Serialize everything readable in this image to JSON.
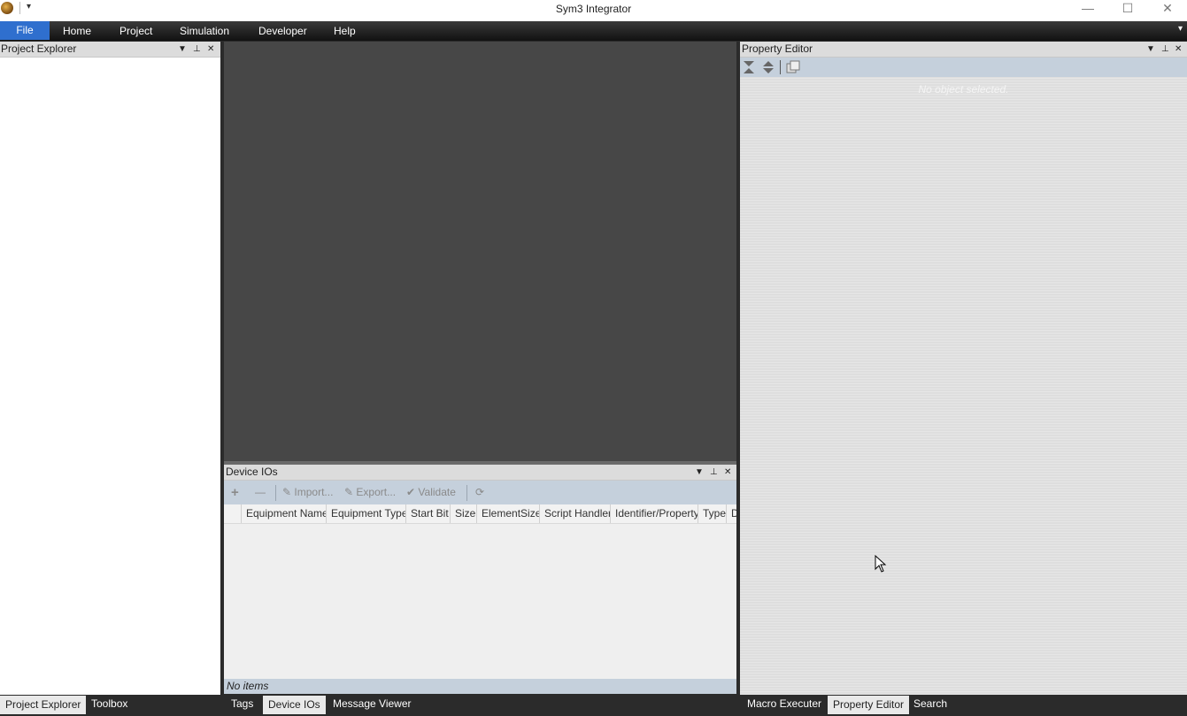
{
  "window": {
    "title": "Sym3 Integrator",
    "minimize_glyph": "—",
    "maximize_glyph": "☐",
    "close_glyph": "✕"
  },
  "quick_access": {
    "dropdown_glyph": "▾"
  },
  "menu": {
    "items": [
      "File",
      "Home",
      "Project",
      "Simulation",
      "Developer",
      "Help"
    ],
    "collapse_glyph": "▾"
  },
  "left_panel": {
    "title": "Project Explorer",
    "tabs": [
      "Project Explorer",
      "Toolbox"
    ],
    "active_tab": "Project Explorer"
  },
  "device_ios": {
    "title": "Device IOs",
    "toolbar": {
      "add_glyph": "+",
      "remove_glyph": "—",
      "import_label": "Import...",
      "export_label": "Export...",
      "validate_label": "Validate"
    },
    "columns": [
      "Equipment Name",
      "Equipment Type",
      "Start Bit",
      "Size",
      "ElementSize",
      "Script Handler",
      "Identifier/Property",
      "Type",
      "D"
    ],
    "status": "No items"
  },
  "center_tabs": {
    "tabs": [
      "Tags",
      "Device IOs",
      "Message Viewer"
    ],
    "active_tab": "Device IOs"
  },
  "property_editor": {
    "title": "Property Editor",
    "empty_message": "No object selected."
  },
  "right_tabs": {
    "tabs": [
      "Macro Executer",
      "Property Editor",
      "Search"
    ],
    "active_tab": "Property Editor"
  },
  "panel_buttons": {
    "dropdown": "▼",
    "pin": "⊥",
    "close": "✕"
  },
  "colors": {
    "accent": "#2f6fce",
    "toolbar": "#c5d0dc",
    "document_bg": "#474747"
  }
}
